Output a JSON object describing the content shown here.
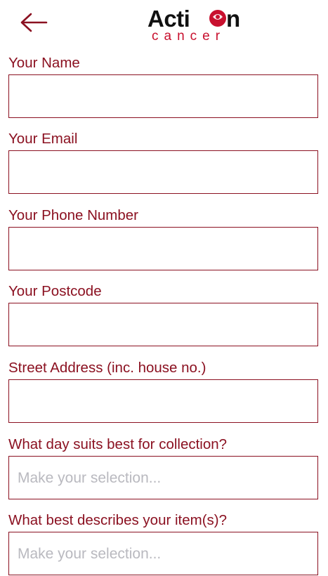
{
  "brand": {
    "logo_word_top": "Action",
    "logo_word_bottom": "cancer",
    "accent_color": "#8b1121",
    "logo_red": "#c8102e"
  },
  "header": {
    "back_icon": "arrow-left-icon"
  },
  "form": {
    "fields": [
      {
        "label": "Your Name",
        "type": "text",
        "value": ""
      },
      {
        "label": "Your Email",
        "type": "email",
        "value": ""
      },
      {
        "label": "Your Phone Number",
        "type": "tel",
        "value": ""
      },
      {
        "label": "Your Postcode",
        "type": "text",
        "value": ""
      },
      {
        "label": "Street Address (inc. house no.)",
        "type": "text",
        "value": ""
      },
      {
        "label": "What day suits best for collection?",
        "type": "select",
        "placeholder": "Make your selection..."
      },
      {
        "label": "What best describes your item(s)?",
        "type": "select",
        "placeholder": "Make your selection..."
      }
    ]
  }
}
